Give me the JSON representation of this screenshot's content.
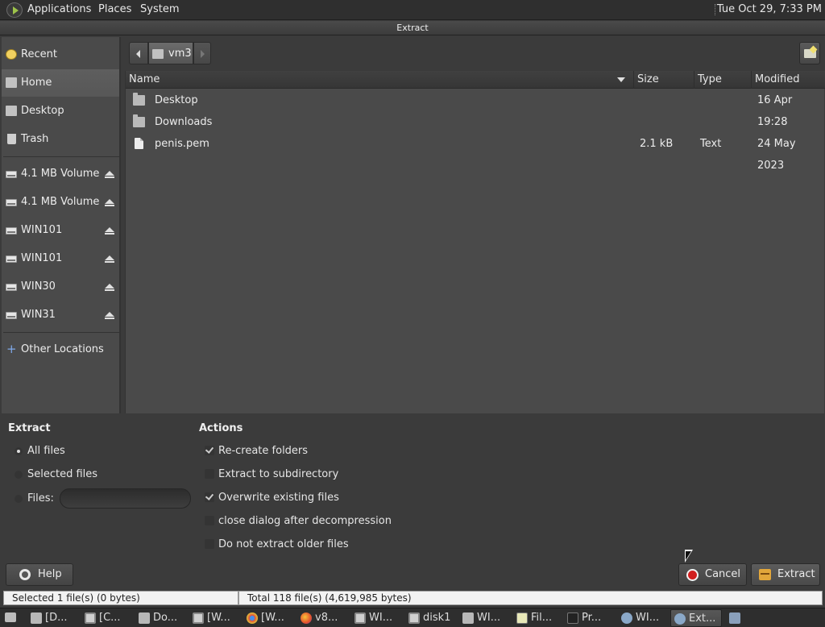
{
  "top_panel": {
    "menus": [
      "Applications",
      "Places",
      "System"
    ],
    "clock": "Tue Oct 29,  7:33 PM"
  },
  "window": {
    "title": "Extract"
  },
  "sidebar": {
    "places": [
      {
        "label": "Recent",
        "icon": "recent-icon"
      },
      {
        "label": "Home",
        "icon": "home-folder-icon",
        "active": true
      },
      {
        "label": "Desktop",
        "icon": "desktop-folder-icon"
      },
      {
        "label": "Trash",
        "icon": "trash-icon"
      }
    ],
    "volumes": [
      {
        "label": "4.1 MB Volume",
        "icon": "drive-icon"
      },
      {
        "label": "4.1 MB Volume",
        "icon": "drive-icon"
      },
      {
        "label": "WIN101",
        "icon": "drive-icon"
      },
      {
        "label": "WIN101",
        "icon": "drive-icon"
      },
      {
        "label": "WIN30",
        "icon": "drive-icon"
      },
      {
        "label": "WIN31",
        "icon": "drive-icon"
      }
    ],
    "other": {
      "label": "Other Locations",
      "icon": "plus-icon"
    }
  },
  "path_bar": {
    "current": "vm3"
  },
  "file_list": {
    "columns": {
      "name": "Name",
      "size": "Size",
      "type": "Type",
      "modified": "Modified"
    },
    "rows": [
      {
        "name": "Desktop",
        "size": "",
        "type": "",
        "modified": "16 Apr",
        "icon": "folder-icon"
      },
      {
        "name": "Downloads",
        "size": "",
        "type": "",
        "modified": "19:28",
        "icon": "folder-icon"
      },
      {
        "name": "penis.pem",
        "size": "2.1 kB",
        "type": "Text",
        "modified": "24 May 2023",
        "icon": "document-icon"
      }
    ]
  },
  "extract_options": {
    "title": "Extract",
    "all_files": "All files",
    "selected_files": "Selected files",
    "files": "Files:",
    "files_value": "",
    "selected": "all_files"
  },
  "actions": {
    "title": "Actions",
    "recreate_folders": {
      "label": "Re-create folders",
      "checked": true
    },
    "extract_to_subdir": {
      "label": "Extract to subdirectory",
      "checked": false
    },
    "overwrite": {
      "label": "Overwrite existing files",
      "checked": true
    },
    "close_dialog": {
      "label": "close dialog after decompression",
      "checked": false
    },
    "no_older": {
      "label": "Do not extract older files",
      "checked": false
    }
  },
  "buttons": {
    "help": "Help",
    "cancel": "Cancel",
    "extract": "Extract"
  },
  "status": {
    "selected": "Selected 1 file(s) (0 bytes)",
    "total": "Total 118 file(s) (4,619,985 bytes)"
  },
  "taskbar": [
    {
      "label": "[D...",
      "icon": "folder-icon"
    },
    {
      "label": "[C...",
      "icon": "terminal-icon"
    },
    {
      "label": "Do...",
      "icon": "folder-icon"
    },
    {
      "label": "[W...",
      "icon": "terminal-icon"
    },
    {
      "label": "[W...",
      "icon": "chrome-icon"
    },
    {
      "label": "v8...",
      "icon": "firefox-icon"
    },
    {
      "label": "WI...",
      "icon": "terminal-icon"
    },
    {
      "label": "disk1",
      "icon": "terminal-icon"
    },
    {
      "label": "WI...",
      "icon": "folder-icon"
    },
    {
      "label": "Fil...",
      "icon": "notes-icon"
    },
    {
      "label": "Pr...",
      "icon": "system-monitor-icon"
    },
    {
      "label": "WI...",
      "icon": "network-icon"
    },
    {
      "label": "Ext...",
      "icon": "archive-manager-icon",
      "active": true
    },
    {
      "label": "",
      "icon": "window-icon"
    }
  ]
}
